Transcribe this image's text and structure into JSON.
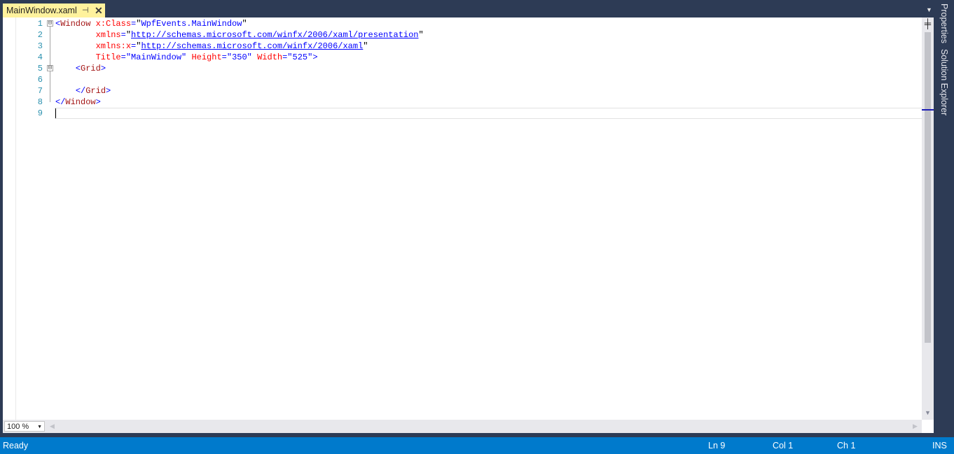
{
  "tab": {
    "title": "MainWindow.xaml",
    "pin_glyph": "⊣",
    "close_glyph": "✕",
    "icons": [
      "pin-icon",
      "close-icon"
    ]
  },
  "editor": {
    "line_numbers": [
      "1",
      "2",
      "3",
      "4",
      "5",
      "6",
      "7",
      "8",
      "9"
    ],
    "fold_markers": [
      "⊟",
      "⊟"
    ],
    "code": {
      "l1": {
        "open": "<",
        "tag": "Window",
        "attr": " x:Class",
        "eq": "=",
        "q1": "\"",
        "val": "WpfEvents.MainWindow",
        "q2": "\""
      },
      "l2": {
        "indent": "        ",
        "attr": "xmlns",
        "eq": "=",
        "q1": "\"",
        "url": "http://schemas.microsoft.com/winfx/2006/xaml/presentation",
        "q2": "\""
      },
      "l3": {
        "indent": "        ",
        "attr": "xmlns:x",
        "eq": "=",
        "q1": "\"",
        "url": "http://schemas.microsoft.com/winfx/2006/xaml",
        "q2": "\""
      },
      "l4": {
        "indent": "        ",
        "attr1": "Title",
        "val1": "=\"MainWindow\"",
        "attr2": " Height",
        "val2": "=\"350\"",
        "attr3": " Width",
        "val3": "=\"525\"",
        "close": ">"
      },
      "l5": {
        "indent": "    ",
        "open": "<",
        "tag": "Grid",
        "close": ">"
      },
      "l7": {
        "indent": "    ",
        "open": "</",
        "tag": "Grid",
        "close": ">"
      },
      "l8": {
        "open": "</",
        "tag": "Window",
        "close": ">"
      }
    },
    "zoom": "100 %"
  },
  "side_tabs": {
    "properties": "Properties",
    "solution_explorer": "Solution Explorer"
  },
  "status": {
    "ready": "Ready",
    "ln": "Ln 9",
    "col": "Col 1",
    "ch": "Ch 1",
    "mode": "INS"
  },
  "colors": {
    "accent": "#007acc",
    "chrome": "#2d3b55",
    "active_tab": "#fff29d"
  }
}
